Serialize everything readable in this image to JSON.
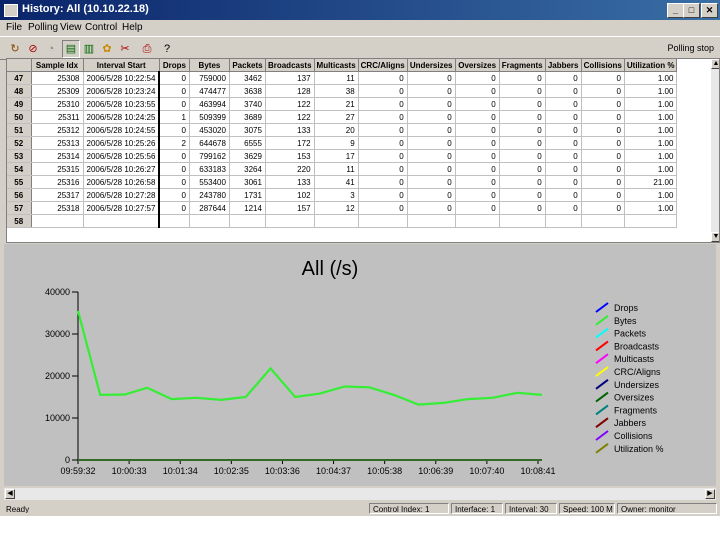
{
  "window": {
    "title": "History: All (10.10.22.18)"
  },
  "titlebar_buttons": [
    "_",
    "□",
    "✕"
  ],
  "menu": [
    "File",
    "Polling",
    "View",
    "Control",
    "Help"
  ],
  "toolbar": {
    "right_text": "Polling stop"
  },
  "table": {
    "columns": [
      "",
      "Sample Idx",
      "Interval Start",
      "Drops",
      "Bytes",
      "Packets",
      "Broadcasts",
      "Multicasts",
      "CRC/Aligns",
      "Undersizes",
      "Oversizes",
      "Fragments",
      "Jabbers",
      "Collisions",
      "Utilization %"
    ],
    "rows": [
      [
        "47",
        "25308",
        "2006/5/28 10:22:54",
        "0",
        "759000",
        "3462",
        "137",
        "11",
        "0",
        "0",
        "0",
        "0",
        "0",
        "0",
        "1.00"
      ],
      [
        "48",
        "25309",
        "2006/5/28 10:23:24",
        "0",
        "474477",
        "3638",
        "128",
        "38",
        "0",
        "0",
        "0",
        "0",
        "0",
        "0",
        "1.00"
      ],
      [
        "49",
        "25310",
        "2006/5/28 10:23:55",
        "0",
        "463994",
        "3740",
        "122",
        "21",
        "0",
        "0",
        "0",
        "0",
        "0",
        "0",
        "1.00"
      ],
      [
        "50",
        "25311",
        "2006/5/28 10:24:25",
        "1",
        "509399",
        "3689",
        "122",
        "27",
        "0",
        "0",
        "0",
        "0",
        "0",
        "0",
        "1.00"
      ],
      [
        "51",
        "25312",
        "2006/5/28 10:24:55",
        "0",
        "453020",
        "3075",
        "133",
        "20",
        "0",
        "0",
        "0",
        "0",
        "0",
        "0",
        "1.00"
      ],
      [
        "52",
        "25313",
        "2006/5/28 10:25:26",
        "2",
        "644678",
        "6555",
        "172",
        "9",
        "0",
        "0",
        "0",
        "0",
        "0",
        "0",
        "1.00"
      ],
      [
        "53",
        "25314",
        "2006/5/28 10:25:56",
        "0",
        "799162",
        "3629",
        "153",
        "17",
        "0",
        "0",
        "0",
        "0",
        "0",
        "0",
        "1.00"
      ],
      [
        "54",
        "25315",
        "2006/5/28 10:26:27",
        "0",
        "633183",
        "3264",
        "220",
        "11",
        "0",
        "0",
        "0",
        "0",
        "0",
        "0",
        "1.00"
      ],
      [
        "55",
        "25316",
        "2006/5/28 10:26:58",
        "0",
        "553400",
        "3061",
        "133",
        "41",
        "0",
        "0",
        "0",
        "0",
        "0",
        "0",
        "21.00"
      ],
      [
        "56",
        "25317",
        "2006/5/28 10:27:28",
        "0",
        "243780",
        "1731",
        "102",
        "3",
        "0",
        "0",
        "0",
        "0",
        "0",
        "0",
        "1.00"
      ],
      [
        "57",
        "25318",
        "2006/5/28 10:27:57",
        "0",
        "287644",
        "1214",
        "157",
        "12",
        "0",
        "0",
        "0",
        "0",
        "0",
        "0",
        "1.00"
      ],
      [
        "58",
        "",
        "",
        "",
        "",
        "",
        "",
        "",
        "",
        "",
        "",
        "",
        "",
        "",
        ""
      ]
    ]
  },
  "chart_data": {
    "type": "line",
    "title": "All (/s)",
    "xlabel": "",
    "ylabel": "",
    "ylim": [
      0,
      40000
    ],
    "yticks": [
      "0",
      "10000",
      "20000",
      "30000",
      "40000"
    ],
    "xticks": [
      "09:59:32",
      "10:00:33",
      "10:01:34",
      "10:02:35",
      "10:03:36",
      "10:04:37",
      "10:05:38",
      "10:06:39",
      "10:07:40",
      "10:08:41"
    ],
    "x_span": [
      0,
      9.4
    ],
    "series": [
      {
        "name": "Packets",
        "color": "#33ee33",
        "x": [
          0,
          0.45,
          0.95,
          1.4,
          1.9,
          2.4,
          2.9,
          3.4,
          3.9,
          4.4,
          4.9,
          5.4,
          5.9,
          6.4,
          6.9,
          7.4,
          7.9,
          8.4,
          8.9,
          9.4
        ],
        "values": [
          35500,
          15500,
          15600,
          17200,
          14500,
          14800,
          14300,
          15000,
          21800,
          15000,
          15800,
          17500,
          17300,
          15500,
          13200,
          13600,
          14500,
          14800,
          16000,
          15500
        ]
      },
      {
        "name": "Drops",
        "color": "#0000ff",
        "x": [
          0,
          9.4
        ],
        "values": [
          0,
          0
        ]
      },
      {
        "name": "Bytes",
        "color": "#33ee33",
        "x": [
          0,
          9.4
        ],
        "values": [
          0,
          0
        ]
      },
      {
        "name": "Broadcasts",
        "color": "#ff0000",
        "x": [
          0,
          9.4
        ],
        "values": [
          0,
          0
        ]
      },
      {
        "name": "Multicasts",
        "color": "#ff00ff",
        "x": [
          0,
          9.4
        ],
        "values": [
          0,
          0
        ]
      },
      {
        "name": "Utilization %",
        "color": "#008000",
        "x": [
          0,
          9.4
        ],
        "values": [
          0,
          0
        ]
      }
    ],
    "legend": {
      "position": "right",
      "items": [
        {
          "name": "Drops",
          "color": "#0000ff"
        },
        {
          "name": "Bytes",
          "color": "#33ee33"
        },
        {
          "name": "Packets",
          "color": "#00ffff"
        },
        {
          "name": "Broadcasts",
          "color": "#ff0000"
        },
        {
          "name": "Multicasts",
          "color": "#ff00ff"
        },
        {
          "name": "CRC/Aligns",
          "color": "#ffff00"
        },
        {
          "name": "Undersizes",
          "color": "#000080"
        },
        {
          "name": "Oversizes",
          "color": "#006400"
        },
        {
          "name": "Fragments",
          "color": "#008080"
        },
        {
          "name": "Jabbers",
          "color": "#800000"
        },
        {
          "name": "Collisions",
          "color": "#8000ff"
        },
        {
          "name": "Utilization %",
          "color": "#808000"
        }
      ]
    }
  },
  "statusbar": {
    "ready": "Ready",
    "control_index": "Control Index: 1",
    "interface": "Interface: 1",
    "interval": "Interval: 30",
    "speed": "Speed: 100 M",
    "owner": "Owner: monitor"
  }
}
